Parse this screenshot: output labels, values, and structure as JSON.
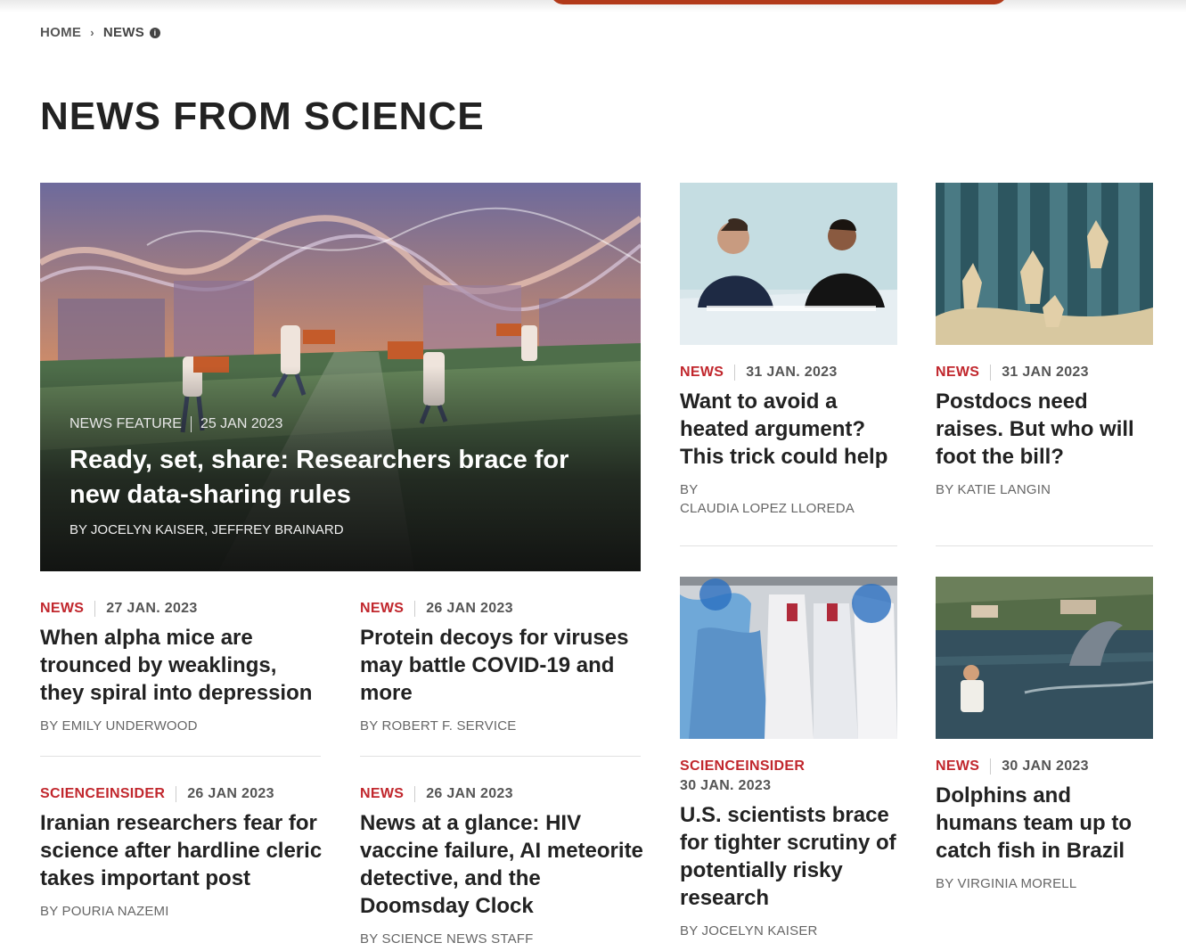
{
  "breadcrumb": {
    "home": "HOME",
    "separator": "›",
    "current": "NEWS",
    "info_glyph": "i"
  },
  "page_title": "NEWS FROM SCIENCE",
  "colors": {
    "accent": "#c1272d",
    "top_accent": "#b23a1a",
    "text": "#222222",
    "muted": "#666666"
  },
  "featured": {
    "category": "NEWS FEATURE",
    "date": "25 JAN 2023",
    "headline": "Ready, set, share: Researchers brace for new data-sharing rules",
    "byline": "BY JOCELYN KAISER, JEFFREY BRAINARD",
    "image_icon": "illustration-researchers-carrying-boxes"
  },
  "articles": [
    {
      "category": "NEWS",
      "date": "31 JAN. 2023",
      "headline": "Want to avoid a heated argument? This trick could help",
      "byline": "BY\nCLAUDIA LOPEZ LLOREDA",
      "image_icon": "photo-two-people-arguing"
    },
    {
      "category": "NEWS",
      "date": "31 JAN 2023",
      "headline": "Postdocs need raises. But who will foot the bill?",
      "byline": "BY KATIE LANGIN",
      "image_icon": "illustration-figures-in-forest"
    },
    {
      "category": "NEWS",
      "date": "27 JAN. 2023",
      "headline": "When alpha mice are trounced by weaklings, they spiral into depression",
      "byline": "BY EMILY UNDERWOOD"
    },
    {
      "category": "NEWS",
      "date": "26 JAN 2023",
      "headline": "Protein decoys for viruses may battle COVID-19 and more",
      "byline": "BY ROBERT F. SERVICE"
    },
    {
      "category": "SCIENCEINSIDER",
      "date": "30 JAN. 2023",
      "headline": "U.S. scientists brace for tighter scrutiny of potentially risky research",
      "byline": "BY JOCELYN KAISER",
      "image_icon": "photo-protective-suits-hanging"
    },
    {
      "category": "NEWS",
      "date": "30 JAN 2023",
      "headline": "Dolphins and humans team up to catch fish in Brazil",
      "byline": "BY VIRGINIA MORELL",
      "image_icon": "photo-fisherman-and-dolphin"
    },
    {
      "category": "SCIENCEINSIDER",
      "date": "26 JAN 2023",
      "headline": "Iranian researchers fear for science after hardline cleric takes important post",
      "byline": "BY POURIA NAZEMI"
    },
    {
      "category": "NEWS",
      "date": "26 JAN 2023",
      "headline": "News at a glance: HIV vaccine failure, AI meteorite detective, and the Doomsday Clock",
      "byline": "BY SCIENCE NEWS STAFF"
    }
  ]
}
